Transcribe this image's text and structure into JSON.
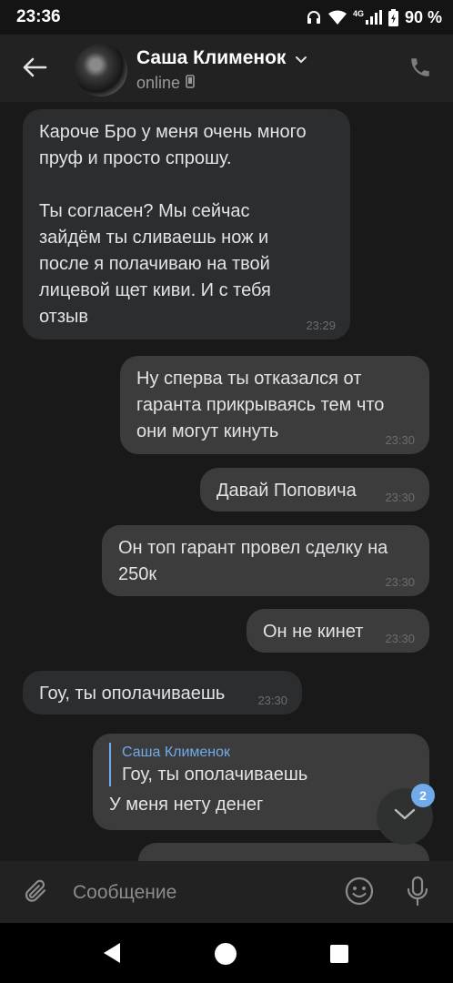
{
  "status_bar": {
    "time": "23:36",
    "network_label": "4G",
    "battery": "90 %"
  },
  "header": {
    "contact_name": "Саша Клименок",
    "status": "online"
  },
  "messages": [
    {
      "direction": "in",
      "text": "Кароче Бро у меня очень много\nпруф и просто спрошу.\n\nТы согласен? Мы сейчас\nзайдём ты сливаешь нож и\nпосле я полачиваю на твой\nлицевой щет киви. И с тебя\nотзыв",
      "time": "23:29"
    },
    {
      "direction": "out",
      "text": "Ну сперва ты отказался от\nгаранта прикрываясь тем что\nони могут кинуть",
      "time": "23:30"
    },
    {
      "direction": "out",
      "text": "Давай Поповича",
      "time": "23:30"
    },
    {
      "direction": "out",
      "text": "Он топ гарант провел сделку на\n250к",
      "time": "23:30"
    },
    {
      "direction": "out",
      "text": "Он не кинет",
      "time": "23:30"
    },
    {
      "direction": "in",
      "text": "Гоу, ты ополачиваешь",
      "time": "23:30"
    },
    {
      "direction": "out",
      "reply_author": "Саша Клименок",
      "reply_text": "Гоу, ты ополачиваешь",
      "text": "У меня нету денег"
    }
  ],
  "scroll_down": {
    "unread_count": "2"
  },
  "composer": {
    "placeholder": "Сообщение"
  },
  "colors": {
    "accent": "#71aaeb",
    "incoming_bubble": "#2c2d2e",
    "outgoing_bubble": "#3c3c3d",
    "background": "#19191a"
  },
  "icons": {
    "back": "arrow-left-icon",
    "call": "phone-icon",
    "attach": "paperclip-icon",
    "emoji": "smiley-icon",
    "mic": "microphone-icon",
    "scroll": "chevron-down-icon"
  }
}
